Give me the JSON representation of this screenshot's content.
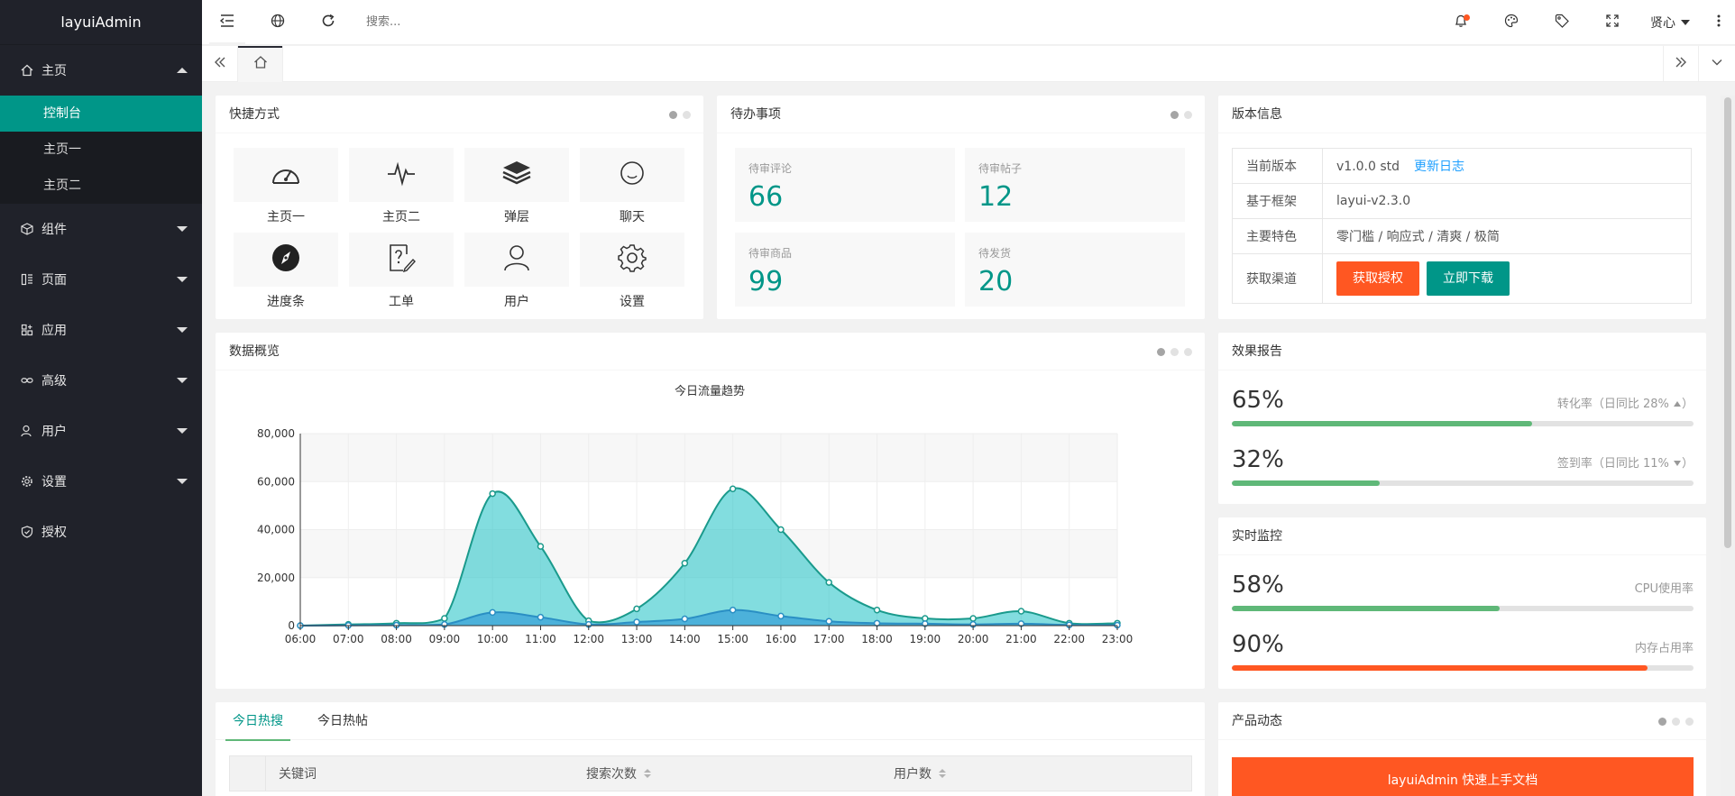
{
  "app": {
    "logo": "layuiAdmin"
  },
  "sidebar": {
    "items": [
      {
        "label": "主页",
        "icon": "home-icon",
        "expanded": true
      },
      {
        "label": "组件",
        "icon": "cube-icon"
      },
      {
        "label": "页面",
        "icon": "template-icon"
      },
      {
        "label": "应用",
        "icon": "app-icon"
      },
      {
        "label": "高级",
        "icon": "senior-icon"
      },
      {
        "label": "用户",
        "icon": "user-icon"
      },
      {
        "label": "设置",
        "icon": "gear-icon"
      },
      {
        "label": "授权",
        "icon": "auz-icon"
      }
    ],
    "home_sub": [
      "控制台",
      "主页一",
      "主页二"
    ],
    "active_sub": "控制台"
  },
  "header": {
    "search_placeholder": "搜索...",
    "user": "贤心"
  },
  "shortcuts": {
    "title": "快捷方式",
    "items": [
      {
        "label": "主页一",
        "icon": "dashboard-icon"
      },
      {
        "label": "主页二",
        "icon": "chart-pulse-icon"
      },
      {
        "label": "弹层",
        "icon": "layers-icon"
      },
      {
        "label": "聊天",
        "icon": "chat-face-icon"
      },
      {
        "label": "进度条",
        "icon": "compass-icon"
      },
      {
        "label": "工单",
        "icon": "ticket-icon"
      },
      {
        "label": "用户",
        "icon": "user-icon"
      },
      {
        "label": "设置",
        "icon": "gear-icon"
      }
    ]
  },
  "todos": {
    "title": "待办事项",
    "items": [
      {
        "label": "待审评论",
        "value": "66"
      },
      {
        "label": "待审帖子",
        "value": "12"
      },
      {
        "label": "待审商品",
        "value": "99"
      },
      {
        "label": "待发货",
        "value": "20"
      }
    ]
  },
  "version": {
    "title": "版本信息",
    "rows": [
      {
        "k": "当前版本",
        "v": "v1.0.0 std",
        "link": "更新日志"
      },
      {
        "k": "基于框架",
        "v": "layui-v2.3.0"
      },
      {
        "k": "主要特色",
        "v": "零门槛 / 响应式 / 清爽 / 极简"
      },
      {
        "k": "获取渠道",
        "btn1": "获取授权",
        "btn2": "立即下载"
      }
    ]
  },
  "overview": {
    "title": "数据概览"
  },
  "report": {
    "title": "效果报告",
    "rows": [
      {
        "value": "65%",
        "label": "转化率（日同比 28%",
        "trend": "up",
        "percent": 65
      },
      {
        "value": "32%",
        "label": "签到率（日同比 11%",
        "trend": "down",
        "percent": 32
      }
    ]
  },
  "monitor": {
    "title": "实时监控",
    "rows": [
      {
        "value": "58%",
        "label": "CPU使用率",
        "percent": 58,
        "color": "#5fb878"
      },
      {
        "value": "90%",
        "label": "内存占用率",
        "percent": 90,
        "color": "#ff5722"
      }
    ]
  },
  "hot": {
    "tabs": [
      "今日热搜",
      "今日热帖"
    ],
    "columns": [
      "关键词",
      "搜索次数",
      "用户数"
    ]
  },
  "product": {
    "title": "产品动态",
    "button": "layuiAdmin 快速上手文档"
  },
  "colors": {
    "accent": "#009688",
    "orange": "#ff5722",
    "sidebar": "#20222a",
    "green": "#5fb878"
  },
  "chart_data": {
    "type": "area",
    "title": "今日流量趋势",
    "x": [
      "06:00",
      "07:00",
      "08:00",
      "09:00",
      "10:00",
      "11:00",
      "12:00",
      "13:00",
      "14:00",
      "15:00",
      "16:00",
      "17:00",
      "18:00",
      "19:00",
      "20:00",
      "21:00",
      "22:00",
      "23:00"
    ],
    "ylim": [
      0,
      80000
    ],
    "yticks": [
      "0",
      "20,000",
      "40,000",
      "60,000",
      "80,000"
    ],
    "grid": true,
    "series": [
      {
        "values": [
          0,
          500,
          1000,
          3000,
          55000,
          33000,
          2000,
          7000,
          26000,
          57000,
          40000,
          18000,
          6500,
          3000,
          3000,
          6000,
          1000,
          1000
        ],
        "color": "#2ec7c9"
      },
      {
        "values": [
          0,
          100,
          200,
          500,
          5500,
          3500,
          500,
          1500,
          2800,
          6500,
          4000,
          1800,
          1000,
          800,
          500,
          800,
          300,
          200
        ],
        "color": "#3aa1d8"
      }
    ]
  }
}
